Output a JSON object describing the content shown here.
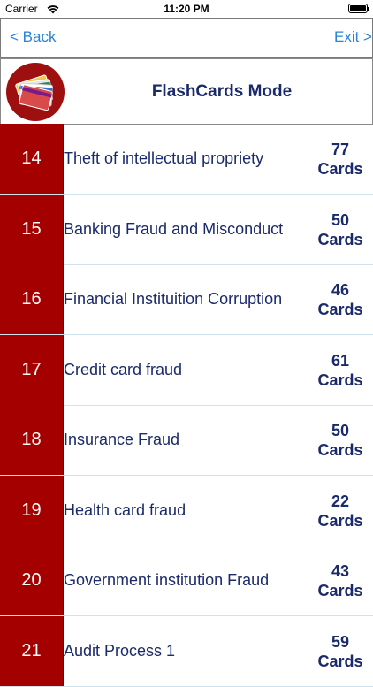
{
  "status": {
    "carrier": "Carrier",
    "time": "11:20 PM"
  },
  "nav": {
    "back_label": "<  Back",
    "exit_label": "Exit >"
  },
  "header": {
    "title": "FlashCards Mode"
  },
  "colors": {
    "accent": "#a40000",
    "text": "#1b2a6b",
    "link": "#2a83d6"
  },
  "items": [
    {
      "number": "14",
      "title": "Theft of intellectual propriety",
      "count": "77",
      "unit": "Cards"
    },
    {
      "number": "15",
      "title": "Banking Fraud and Misconduct",
      "count": "50",
      "unit": "Cards"
    },
    {
      "number": "16",
      "title": "Financial Instituition Corruption",
      "count": "46",
      "unit": "Cards"
    },
    {
      "number": "17",
      "title": "Credit card fraud",
      "count": "61",
      "unit": "Cards"
    },
    {
      "number": "18",
      "title": "Insurance Fraud",
      "count": "50",
      "unit": "Cards"
    },
    {
      "number": "19",
      "title": "Health card fraud",
      "count": "22",
      "unit": "Cards"
    },
    {
      "number": "20",
      "title": "Government institution Fraud",
      "count": "43",
      "unit": "Cards"
    },
    {
      "number": "21",
      "title": "Audit Process 1",
      "count": "59",
      "unit": "Cards"
    }
  ]
}
